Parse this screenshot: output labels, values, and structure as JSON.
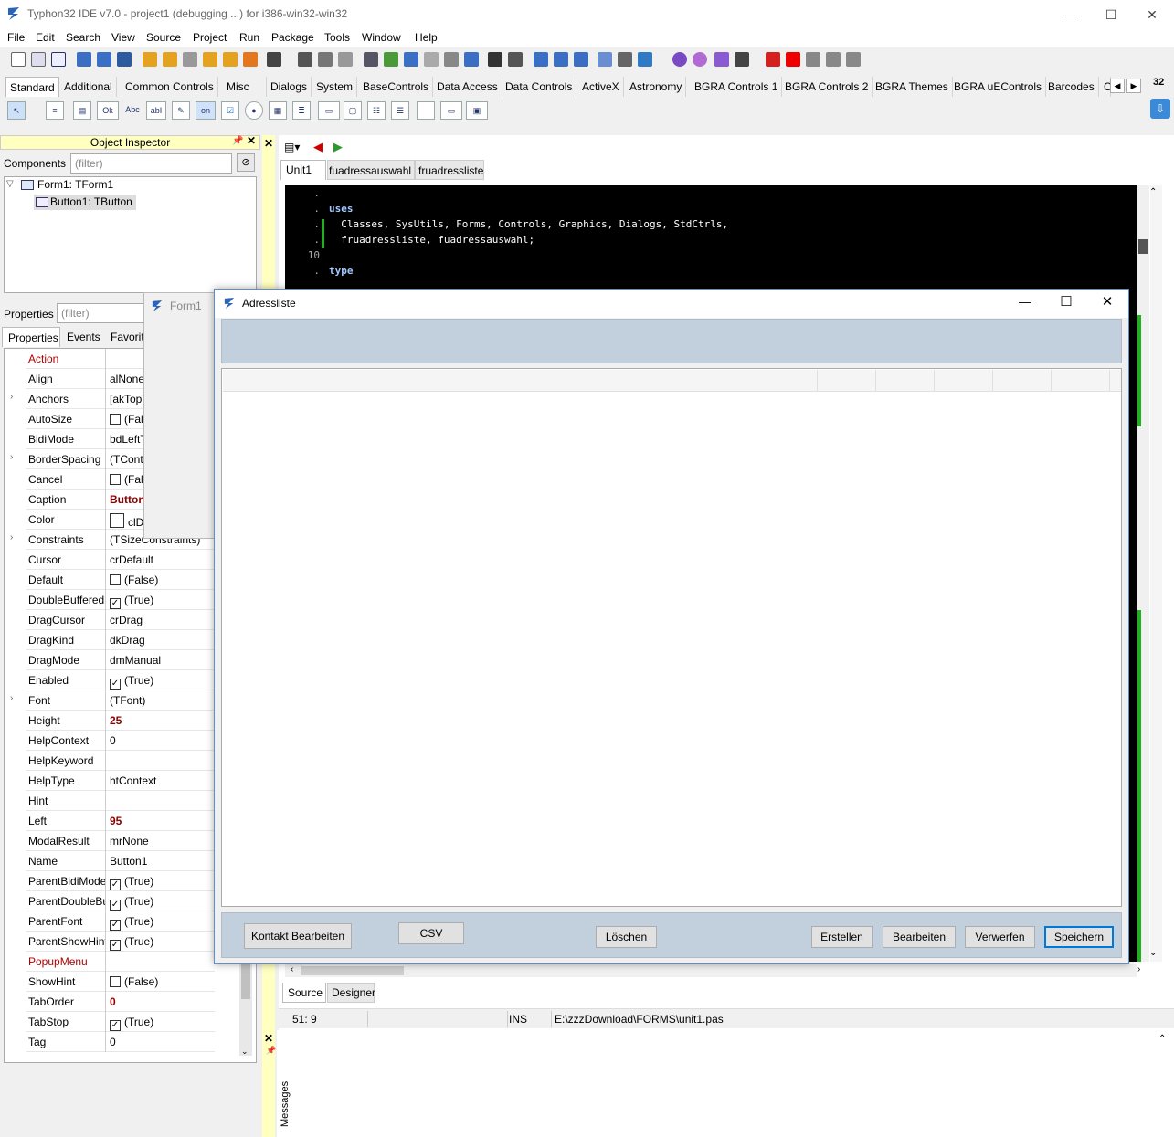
{
  "window": {
    "title": "Typhon32 IDE v7.0 - project1 (debugging ...) for i386-win32-win32",
    "minimize": "—",
    "maximize": "☐",
    "close": "✕"
  },
  "menu": [
    "File",
    "Edit",
    "Search",
    "View",
    "Source",
    "Project",
    "Run",
    "Package",
    "Tools",
    "Window",
    "Help"
  ],
  "palette": {
    "tabs": [
      "Standard",
      "Additional",
      "Common Controls",
      "Misc",
      "Dialogs",
      "System",
      "BaseControls",
      "Data Access",
      "Data Controls",
      "ActiveX",
      "Astronomy",
      "BGRA Controls 1",
      "BGRA Controls 2",
      "BGRA Themes",
      "BGRA uEControls",
      "Barcodes",
      "C"
    ],
    "icon_labels": [
      "Ok",
      "Abc",
      "abI",
      "on"
    ],
    "size_label": "32"
  },
  "object_inspector": {
    "title": "Object Inspector",
    "components_label": "Components",
    "filter_placeholder": "(filter)",
    "tree": [
      "Form1: TForm1",
      "Button1: TButton"
    ],
    "properties_label": "Properties",
    "tabs": [
      "Properties",
      "Events",
      "Favorit"
    ],
    "props": [
      {
        "name": "Action",
        "value": "",
        "highlight": true
      },
      {
        "name": "Align",
        "value": "alNone"
      },
      {
        "name": "Anchors",
        "value": "[akTop,",
        "expand": true
      },
      {
        "name": "AutoSize",
        "value": "(Fal",
        "check": false
      },
      {
        "name": "BidiMode",
        "value": "bdLeftT"
      },
      {
        "name": "BorderSpacing",
        "value": "(TContr",
        "expand": true
      },
      {
        "name": "Cancel",
        "value": "(Fal",
        "check": false
      },
      {
        "name": "Caption",
        "value": "Button",
        "bold": true
      },
      {
        "name": "Color",
        "value": "clDe",
        "swatch": true
      },
      {
        "name": "Constraints",
        "value": "(TSizeConstraints)",
        "expand": true
      },
      {
        "name": "Cursor",
        "value": "crDefault"
      },
      {
        "name": "Default",
        "value": "(False)",
        "check": false
      },
      {
        "name": "DoubleBuffered",
        "value": "(True)",
        "check": true
      },
      {
        "name": "DragCursor",
        "value": "crDrag"
      },
      {
        "name": "DragKind",
        "value": "dkDrag"
      },
      {
        "name": "DragMode",
        "value": "dmManual"
      },
      {
        "name": "Enabled",
        "value": "(True)",
        "check": true
      },
      {
        "name": "Font",
        "value": "(TFont)",
        "expand": true
      },
      {
        "name": "Height",
        "value": "25",
        "bold": true
      },
      {
        "name": "HelpContext",
        "value": "0"
      },
      {
        "name": "HelpKeyword",
        "value": ""
      },
      {
        "name": "HelpType",
        "value": "htContext"
      },
      {
        "name": "Hint",
        "value": ""
      },
      {
        "name": "Left",
        "value": "95",
        "bold": true
      },
      {
        "name": "ModalResult",
        "value": "mrNone"
      },
      {
        "name": "Name",
        "value": "Button1"
      },
      {
        "name": "ParentBidiMode",
        "value": "(True)",
        "check": true
      },
      {
        "name": "ParentDoubleBu",
        "value": "(True)",
        "check": true
      },
      {
        "name": "ParentFont",
        "value": "(True)",
        "check": true
      },
      {
        "name": "ParentShowHint",
        "value": "(True)",
        "check": true
      },
      {
        "name": "PopupMenu",
        "value": "",
        "highlight": true
      },
      {
        "name": "ShowHint",
        "value": "(False)",
        "check": false
      },
      {
        "name": "TabOrder",
        "value": "0",
        "bold": true
      },
      {
        "name": "TabStop",
        "value": "(True)",
        "check": true
      },
      {
        "name": "Tag",
        "value": "0"
      }
    ]
  },
  "editor": {
    "tabs": [
      "Unit1",
      "fuadressauswahl",
      "fruadressliste"
    ],
    "code": [
      {
        "ln": ".",
        "text": "",
        "kw": false
      },
      {
        "ln": ".",
        "text": "uses",
        "kw": true
      },
      {
        "ln": ".",
        "text": "  Classes, SysUtils, Forms, Controls, Graphics, Dialogs, StdCtrls,",
        "kw": false
      },
      {
        "ln": ".",
        "text": "  fruadressliste, fuadressauswahl;",
        "kw": false
      },
      {
        "ln": "10",
        "text": "",
        "kw": false
      },
      {
        "ln": ".",
        "text": "type",
        "kw": true
      }
    ],
    "bottom_tabs": [
      "Source",
      "Designer"
    ],
    "status": {
      "pos": "51:  9",
      "mode": "INS",
      "file": "E:\\zzzDownload\\FORMS\\unit1.pas"
    }
  },
  "form1": {
    "title": "Form1"
  },
  "adressliste": {
    "title": "Adressliste",
    "buttons": [
      "Kontakt Bearbeiten",
      "CSV",
      "Löschen",
      "Erstellen",
      "Bearbeiten",
      "Verwerfen",
      "Speichern"
    ]
  },
  "messages": {
    "label": "Messages"
  },
  "colors": {
    "accent": "#0078d7",
    "panel": "#c2cfdc",
    "code_bg": "#000000",
    "keyword": "#a0c8ff"
  }
}
